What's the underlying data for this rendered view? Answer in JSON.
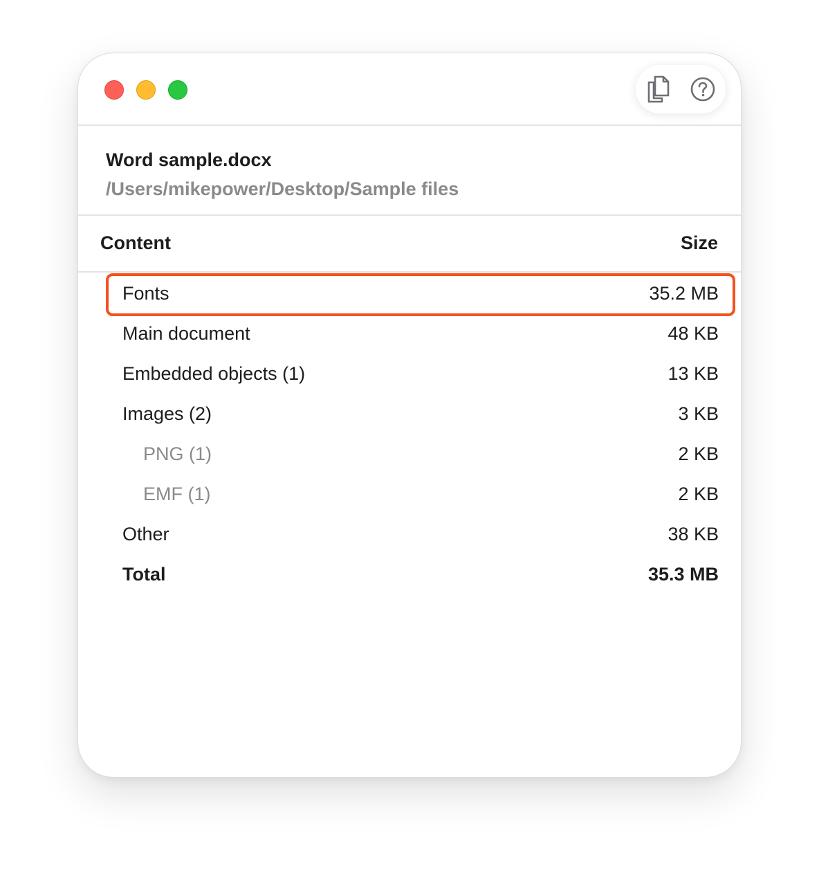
{
  "window": {
    "controls": [
      "close",
      "minimize",
      "maximize"
    ],
    "toolbar": {
      "copy_icon": "copy-documents-icon",
      "help_icon": "help-circle-icon"
    }
  },
  "file": {
    "name": "Word sample.docx",
    "path": "/Users/mikepower/Desktop/Sample files"
  },
  "table": {
    "headers": {
      "content": "Content",
      "size": "Size"
    },
    "rows": [
      {
        "label": "Fonts",
        "size": "35.2 MB",
        "highlighted": true
      },
      {
        "label": "Main document",
        "size": "48 KB"
      },
      {
        "label": "Embedded objects (1)",
        "size": "13 KB"
      },
      {
        "label": "Images (2)",
        "size": "3 KB"
      },
      {
        "label": "PNG (1)",
        "size": "2 KB",
        "sub": true
      },
      {
        "label": "EMF (1)",
        "size": "2 KB",
        "sub": true
      },
      {
        "label": "Other",
        "size": "38 KB"
      },
      {
        "label": "Total",
        "size": "35.3 MB",
        "total": true
      }
    ]
  },
  "colors": {
    "highlight_border": "#f4511e",
    "close": "#fe5f57",
    "minimize": "#febc2e",
    "maximize": "#28c840",
    "secondary_text": "#8a8a8a"
  }
}
